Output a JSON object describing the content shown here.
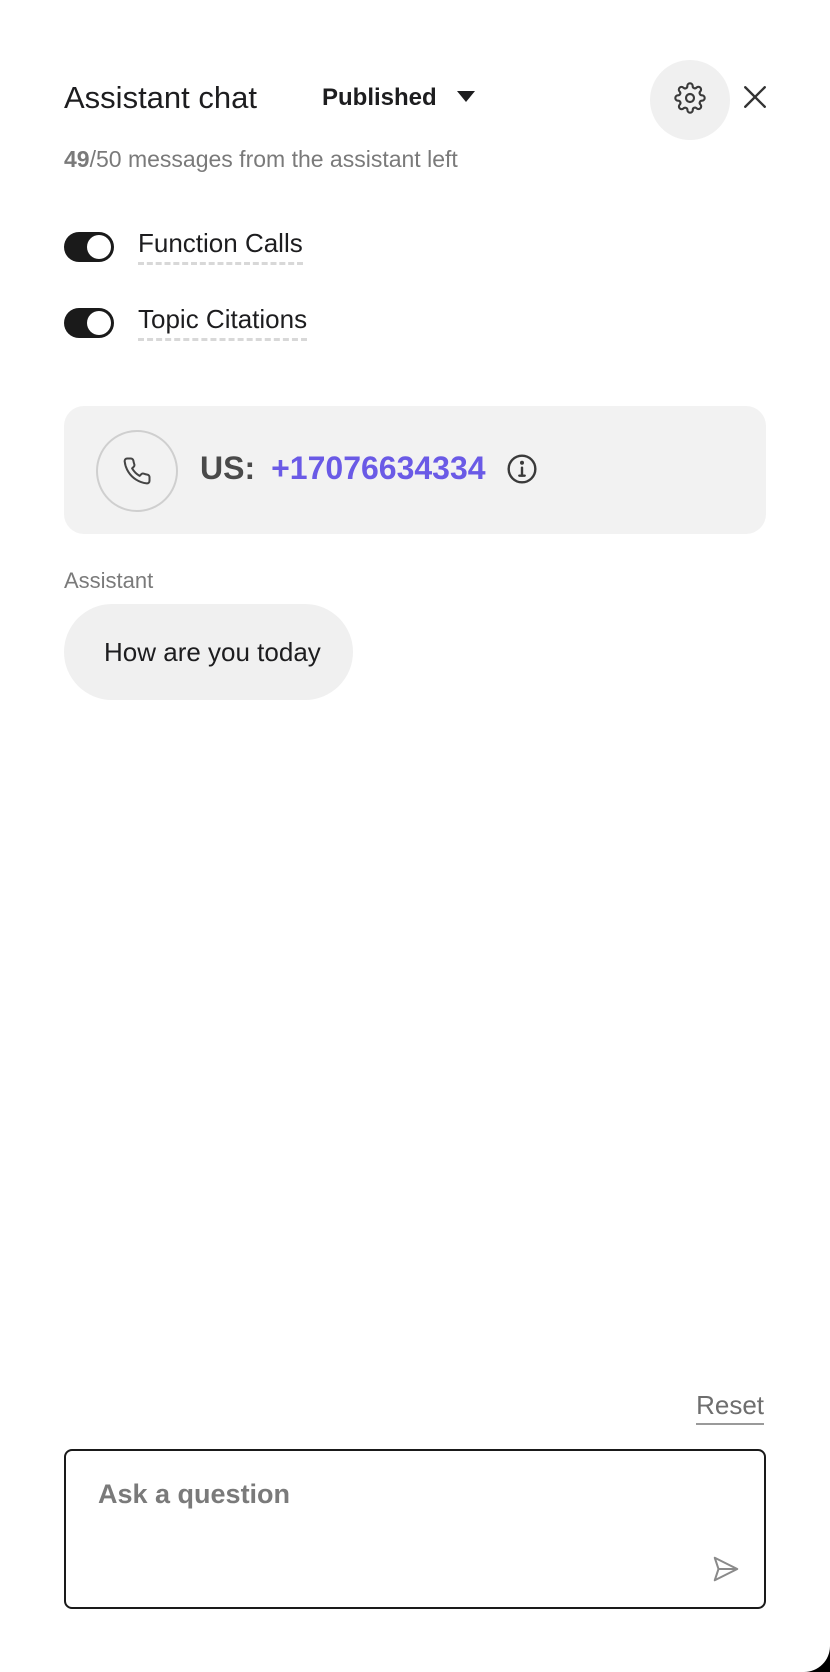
{
  "header": {
    "title": "Assistant chat",
    "status_label": "Published",
    "counter_used": "49",
    "counter_rest": "/50 messages from the assistant left"
  },
  "toggles": [
    {
      "label": "Function Calls",
      "on": true
    },
    {
      "label": "Topic Citations",
      "on": true
    }
  ],
  "phone": {
    "country": "US:",
    "number": "+17076634334"
  },
  "chat": {
    "messages": [
      {
        "sender": "Assistant",
        "text": "How are you today"
      }
    ]
  },
  "footer": {
    "reset_label": "Reset",
    "input_placeholder": "Ask a question",
    "input_value": ""
  },
  "colors": {
    "accent": "#6a5ae6",
    "toggle_on": "#1a1a1a",
    "bubble_bg": "#f0f0f0"
  },
  "icons": {
    "settings": "gear-icon",
    "close": "close-icon",
    "phone": "phone-icon",
    "info": "info-icon",
    "send": "send-icon",
    "dropdown": "chevron-down-icon"
  }
}
